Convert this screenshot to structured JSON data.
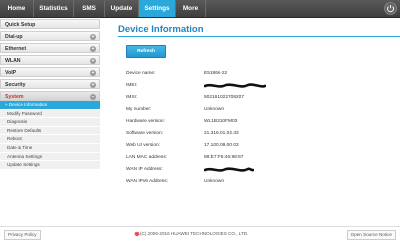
{
  "nav": {
    "tabs": [
      {
        "label": "Home"
      },
      {
        "label": "Statistics"
      },
      {
        "label": "SMS"
      },
      {
        "label": "Update"
      },
      {
        "label": "Settings",
        "active": true
      },
      {
        "label": "More"
      }
    ],
    "logout_icon": "power-icon"
  },
  "sidebar": {
    "categories": [
      {
        "label": "Quick Setup",
        "expandable": false
      },
      {
        "label": "Dial-up",
        "expandable": true
      },
      {
        "label": "Ethernet",
        "expandable": true
      },
      {
        "label": "WLAN",
        "expandable": true
      },
      {
        "label": "VoIP",
        "expandable": true
      },
      {
        "label": "Security",
        "expandable": true
      },
      {
        "label": "System",
        "expandable": true,
        "open": true
      }
    ],
    "system_items": [
      {
        "label": "» Device Information",
        "active": true
      },
      {
        "label": "Modify Password"
      },
      {
        "label": "Diagnosis"
      },
      {
        "label": "Restore Defaults"
      },
      {
        "label": "Reboot"
      },
      {
        "label": "Date & Time"
      },
      {
        "label": "Antenna Settings"
      },
      {
        "label": "Update Settings"
      }
    ]
  },
  "main": {
    "title": "Device Information",
    "refresh_label": "Refresh",
    "rows": [
      {
        "label": "Device name:",
        "value": "E5186s-22"
      },
      {
        "label": "IMEI:",
        "value": "",
        "redacted": true
      },
      {
        "label": "IMSI:",
        "value": "502161022708207"
      },
      {
        "label": "My number:",
        "value": "Unknown"
      },
      {
        "label": "Hardware version:",
        "value": "WL1B310FM03"
      },
      {
        "label": "Software version:",
        "value": "21.316.01.02.33"
      },
      {
        "label": "Web UI version:",
        "value": "17.100.09.00.03"
      },
      {
        "label": "LAN MAC address:",
        "value": "88:E7:F6:46:98:67"
      },
      {
        "label": "WAN IP Address:",
        "value": "",
        "redacted": true
      },
      {
        "label": "WAN IPv6 Address:",
        "value": "Unknown"
      }
    ]
  },
  "footer": {
    "privacy": "Privacy Policy",
    "copyright": "(C) 2006-2016 HUAWEI TECHNOLOGIES CO., LTD.",
    "oss": "Open Source Notice"
  },
  "colors": {
    "accent": "#2aa8dc",
    "title": "#1f86c6",
    "nav": "#4a4a4a"
  }
}
